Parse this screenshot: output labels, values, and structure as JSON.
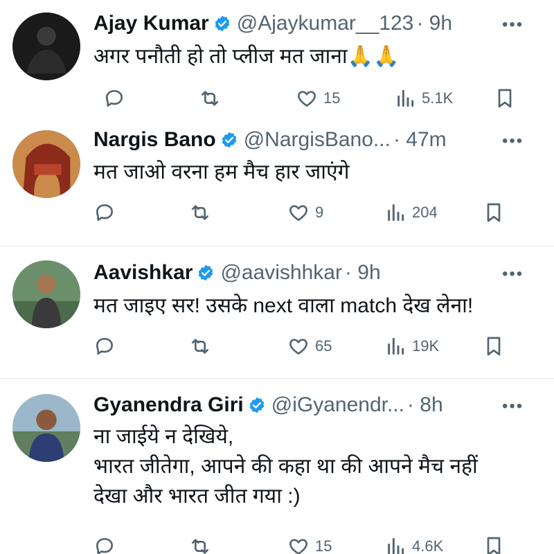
{
  "tweets": [
    {
      "name": "Ajay Kumar",
      "handle": "@Ajaykumar__123",
      "time": "· 9h",
      "lines": [
        "अगर पनौती हो तो प्लीज मत जाना🙏🙏"
      ],
      "replies": "",
      "retweets": "",
      "likes": "15",
      "views": "5.1K"
    },
    {
      "name": "Nargis Bano",
      "handle": "@NargisBano...",
      "time": "· 47m",
      "lines": [
        "मत जाओ वरना हम मैच हार जाएंगे"
      ],
      "replies": "",
      "retweets": "",
      "likes": "9",
      "views": "204"
    },
    {
      "name": "Aavishkar",
      "handle": "@aavishhkar",
      "time": "· 9h",
      "lines": [
        "मत जाइए सर! उसके next वाला match देख लेना!"
      ],
      "replies": "",
      "retweets": "",
      "likes": "65",
      "views": "19K"
    },
    {
      "name": "Gyanendra Giri",
      "handle": "@iGyanendr...",
      "time": "· 8h",
      "lines": [
        "ना जाईये न देखिये,",
        "भारत जीतेगा, आपने की कहा था की आपने मैच नहीं",
        "देखा और भारत जीत गया :)"
      ],
      "replies": "",
      "retweets": "",
      "likes": "15",
      "views": "4.6K"
    }
  ],
  "more_glyph": "•••",
  "icons": {
    "verified": "verified-badge-icon",
    "reply": "reply-icon",
    "retweet": "retweet-icon",
    "like": "heart-icon",
    "views": "views-icon",
    "bookmark": "bookmark-icon"
  },
  "colors": {
    "verified": "#1d9bf0",
    "secondary_text": "#536471",
    "primary_text": "#0f1419"
  }
}
